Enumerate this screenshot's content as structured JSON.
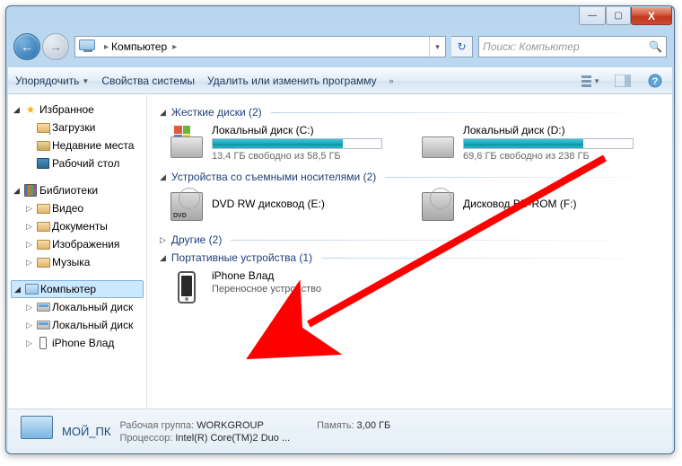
{
  "titlebar": {
    "min": "—",
    "max": "▢",
    "close": "X"
  },
  "address": {
    "location": "Компьютер",
    "sep": "▸",
    "refresh": "↻",
    "search_placeholder": "Поиск: Компьютер",
    "mag": "🔍"
  },
  "toolbar": {
    "organize": "Упорядочить",
    "system_props": "Свойства системы",
    "uninstall": "Удалить или изменить программу",
    "more": "»"
  },
  "sidebar": {
    "favorites": "Избранное",
    "downloads": "Загрузки",
    "recent": "Недавние места",
    "desktop": "Рабочий стол",
    "libraries": "Библиотеки",
    "videos": "Видео",
    "documents": "Документы",
    "pictures": "Изображения",
    "music": "Музыка",
    "computer": "Компьютер",
    "drive_c": "Локальный диск",
    "drive_d": "Локальный диск",
    "iphone": "iPhone Влад"
  },
  "groups": {
    "hdd": {
      "title": "Жесткие диски (2)"
    },
    "removable": {
      "title": "Устройства со съемными носителями (2)"
    },
    "other": {
      "title": "Другие (2)"
    },
    "portable": {
      "title": "Портативные устройства (1)"
    }
  },
  "drives": {
    "c": {
      "name": "Локальный диск (C:)",
      "free": "13,4 ГБ свободно из 58,5 ГБ",
      "fill": 77
    },
    "d": {
      "name": "Локальный диск (D:)",
      "free": "69,6 ГБ свободно из 238 ГБ",
      "fill": 71
    },
    "dvd": {
      "name": "DVD RW дисковод (E:)"
    },
    "bd": {
      "name": "Дисковод BD-ROM (F:)"
    },
    "iphone": {
      "name": "iPhone Влад",
      "sub": "Переносное устройство"
    }
  },
  "details": {
    "name": "МОЙ_ПК",
    "workgroup_lbl": "Рабочая группа:",
    "workgroup_val": "WORKGROUP",
    "cpu_lbl": "Процессор:",
    "cpu_val": "Intel(R) Core(TM)2 Duo ...",
    "mem_lbl": "Память:",
    "mem_val": "3,00 ГБ"
  }
}
